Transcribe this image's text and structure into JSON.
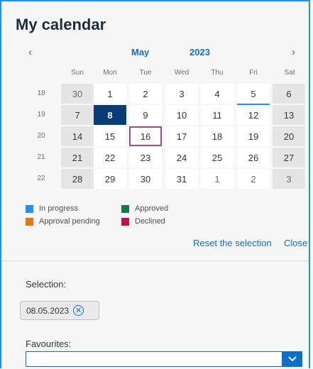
{
  "title": "My calendar",
  "nav": {
    "prev": "‹",
    "next": "›",
    "month": "May",
    "year": "2023"
  },
  "weekdays": [
    "Sun",
    "Mon",
    "Tue",
    "Wed",
    "Thu",
    "Fri",
    "Sat"
  ],
  "weeks": [
    {
      "number": "18",
      "days": [
        "30",
        "1",
        "2",
        "3",
        "4",
        "5",
        "6"
      ]
    },
    {
      "number": "19",
      "days": [
        "7",
        "8",
        "9",
        "10",
        "11",
        "12",
        "13"
      ]
    },
    {
      "number": "20",
      "days": [
        "14",
        "15",
        "16",
        "17",
        "18",
        "19",
        "20"
      ]
    },
    {
      "number": "21",
      "days": [
        "21",
        "22",
        "23",
        "24",
        "25",
        "26",
        "27"
      ]
    },
    {
      "number": "22",
      "days": [
        "28",
        "29",
        "30",
        "31",
        "1",
        "2",
        "3"
      ]
    }
  ],
  "legend": {
    "in_progress": "In progress",
    "approval_pending": "Approval pending",
    "approved": "Approved",
    "declined": "Declined"
  },
  "colors": {
    "in_progress": "#1b90ff",
    "approval_pending": "#e9730c",
    "approved": "#107e3e",
    "declined": "#d20a4a"
  },
  "actions": {
    "reset": "Reset the selection",
    "close": "Close"
  },
  "selection": {
    "label": "Selection:",
    "token": "08.05.2023"
  },
  "favourites": {
    "label": "Favourites:",
    "value": ""
  }
}
